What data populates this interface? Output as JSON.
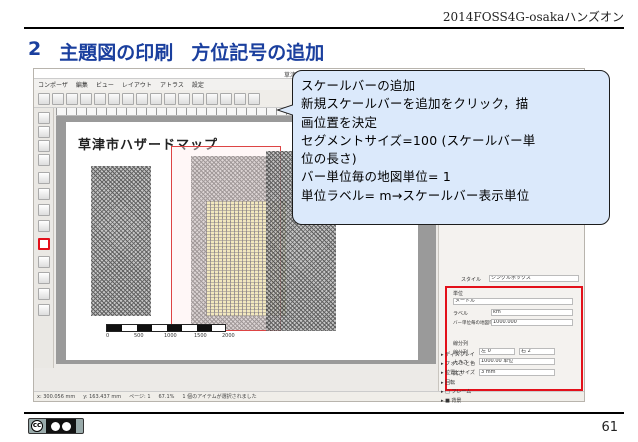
{
  "header": {
    "text": "2014FOSS4G-osakaハンズオン"
  },
  "title": {
    "number": "2",
    "main": "主題図の印刷",
    "sub": "方位記号の追加"
  },
  "footer": {
    "page_number": "61"
  },
  "app": {
    "window_title": "草津",
    "menu": [
      "コンポーザ",
      "編集",
      "ビュー",
      "レイアウト",
      "アトラス",
      "設定"
    ],
    "map_title": "草津市ハザードマップ",
    "scale_ticks": [
      "0",
      "500",
      "1000",
      "1500",
      "2000"
    ],
    "status": {
      "x": "x: 300.056 mm",
      "y": "y: 163.437 mm",
      "page": "ページ: 1",
      "zoom": "67.1%",
      "hint": "1 個のアイテムが選択されました"
    },
    "panel": {
      "style_label": "スタイル",
      "style_value": "シングルボックス",
      "units_group": "単位",
      "units_value": "メートル",
      "label_label": "ラベル",
      "label_value": "km",
      "map_units_label": "バー単位毎の地図単位",
      "map_units_value": "1000.000",
      "segments_group": "線分列",
      "segments_label": "線分列",
      "segments_left": "左 0",
      "segments_right": "右 2",
      "size_label": "大きさ",
      "size_value": "1000.00 単位",
      "height_label": "高さ",
      "height_value": "3 mm",
      "display": "ディスプレイ",
      "fonts": "フォントと色",
      "position": "位置とサイズ",
      "rotation": "回転",
      "frame": "フレーム",
      "background": "背景"
    }
  },
  "callout": {
    "lines": [
      "スケールバーの追加",
      "新規スケールバーを追加をクリック，描",
      "画位置を決定",
      "セグメントサイズ=100 (スケールバー単",
      "位の長さ)",
      "バー単位毎の地図単位= 1",
      "単位ラベル= m→スケールバー表示単位"
    ]
  },
  "license": {
    "cc": "cc",
    "by": "BY",
    "sa": "SA"
  }
}
